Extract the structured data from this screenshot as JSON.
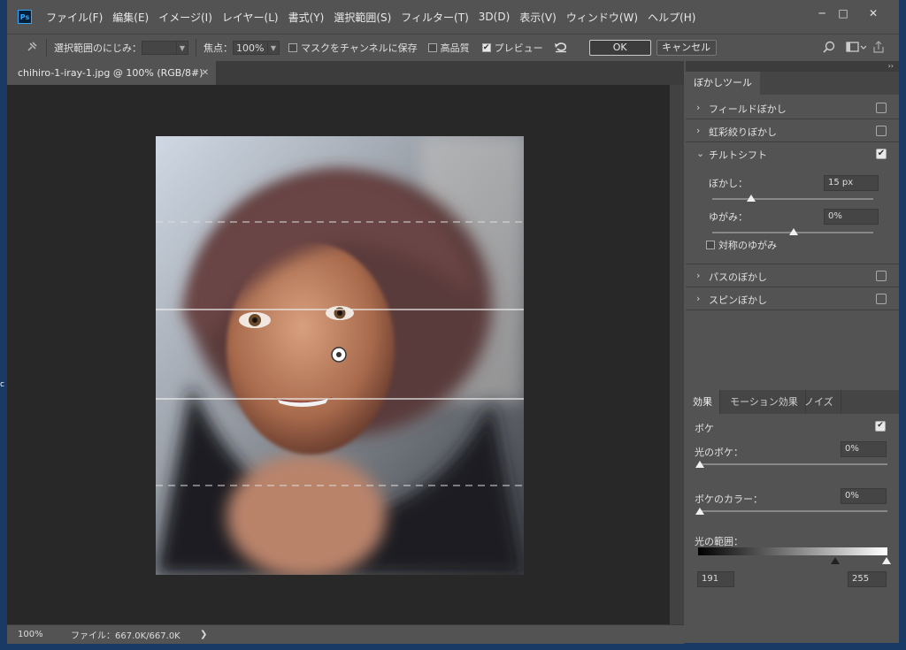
{
  "app": {
    "logo": "Ps"
  },
  "menu": [
    "ファイル(F)",
    "編集(E)",
    "イメージ(I)",
    "レイヤー(L)",
    "書式(Y)",
    "選択範囲(S)",
    "フィルター(T)",
    "3D(D)",
    "表示(V)",
    "ウィンドウ(W)",
    "ヘルプ(H)"
  ],
  "window_controls": {
    "minimize": "─",
    "maximize": "□",
    "close": "✕"
  },
  "options": {
    "selection_feather_label": "選択範囲のにじみ：",
    "selection_feather_value": "",
    "focus_label": "焦点：",
    "focus_value": "100%",
    "save_mask_label": "マスクをチャンネルに保存",
    "high_quality_label": "高品質",
    "preview_label": "プレビュー",
    "preview_checked": "✔",
    "ok_label": "OK",
    "cancel_label": "キャンセル"
  },
  "document": {
    "tab_title": "chihiro-1-iray-1.jpg @ 100% (RGB/8#)",
    "close": "✕"
  },
  "status": {
    "zoom": "100%",
    "file": "ファイル：667.0K/667.0K",
    "arrow": "❯"
  },
  "blur_panel": {
    "collapse": "››",
    "tab": "ぼかしツール",
    "rows": [
      {
        "label": "フィールドぼかし",
        "chevron": "›",
        "checked": ""
      },
      {
        "label": "虹彩絞りぼかし",
        "chevron": "›",
        "checked": ""
      },
      {
        "label": "チルトシフト",
        "chevron": "⌄",
        "checked": "✔"
      },
      {
        "label": "パスのぼかし",
        "chevron": "›",
        "checked": ""
      },
      {
        "label": "スピンぼかし",
        "chevron": "›",
        "checked": ""
      }
    ],
    "tilt": {
      "blur_label": "ぼかし：",
      "blur_value": "15 px",
      "distortion_label": "ゆがみ：",
      "distortion_value": "0%",
      "symmetric_label": "対称のゆがみ"
    }
  },
  "effects_panel": {
    "tabs": [
      "効果",
      "モーション効果",
      "ノイズ"
    ],
    "bokeh_label": "ボケ",
    "bokeh_checked": "✔",
    "light_bokeh_label": "光のボケ：",
    "light_bokeh_value": "0%",
    "bokeh_color_label": "ボケのカラー：",
    "bokeh_color_value": "0%",
    "light_range_label": "光の範囲：",
    "light_range_low": "191",
    "light_range_high": "255"
  },
  "side_mark": "c"
}
